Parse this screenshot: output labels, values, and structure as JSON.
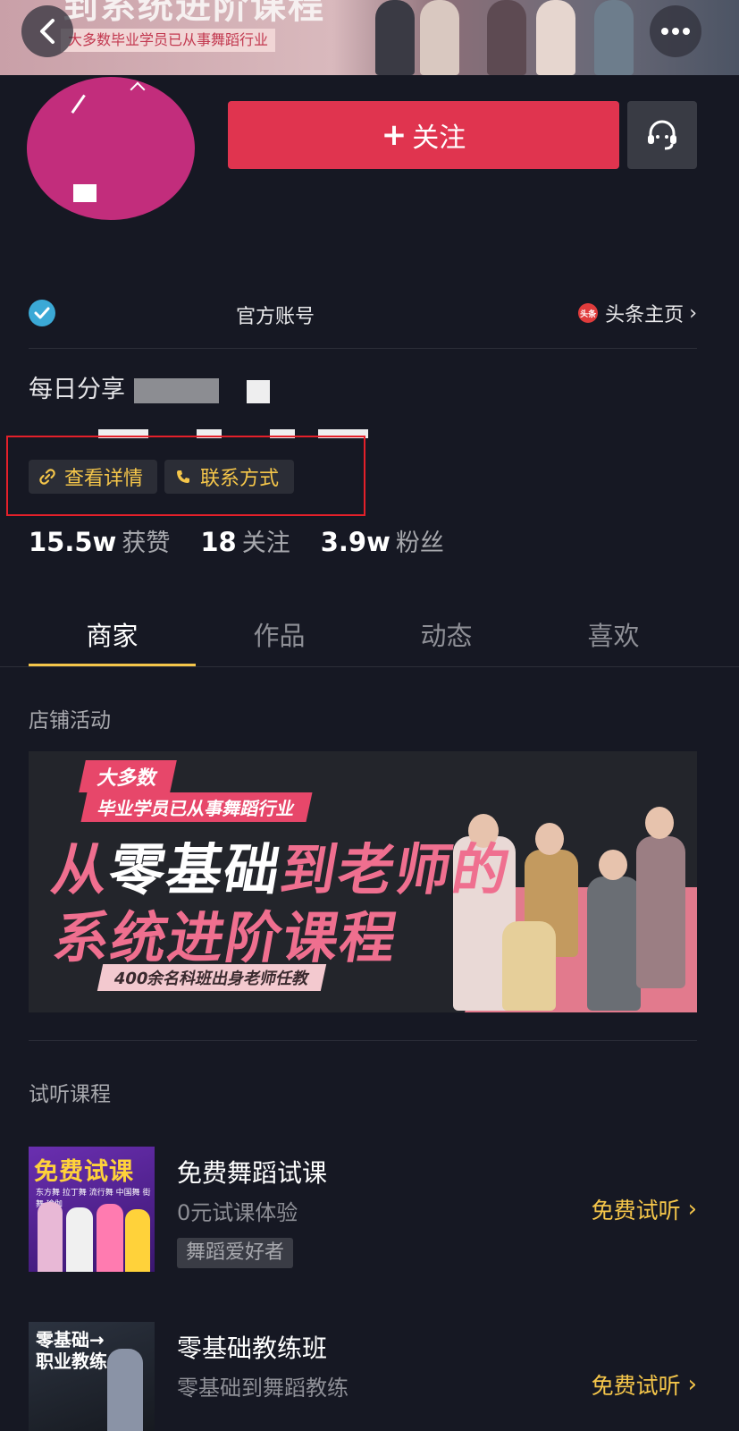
{
  "cover": {
    "title_fragment": "到系统进阶课程",
    "subtitle": "大多数毕业学员已从事舞蹈行业"
  },
  "header": {
    "follow_label": "关注"
  },
  "profile": {
    "verified_text": "官方账号",
    "toutiao_link": "头条主页",
    "toutiao_badge": "头条",
    "bio": "每日分享"
  },
  "links": {
    "details_label": "查看详情",
    "contact_label": "联系方式"
  },
  "stats": [
    {
      "value": "15.5w",
      "label": "获赞"
    },
    {
      "value": "18",
      "label": "关注"
    },
    {
      "value": "3.9w",
      "label": "粉丝"
    }
  ],
  "tabs": [
    {
      "label": "商家",
      "active": true
    },
    {
      "label": "作品",
      "active": false
    },
    {
      "label": "动态",
      "active": false
    },
    {
      "label": "喜欢",
      "active": false
    }
  ],
  "store_section": {
    "title": "店铺活动",
    "banner": {
      "tag1": "大多数",
      "tag2": "毕业学员已从事舞蹈行业",
      "line1_pink_a": "从",
      "line1_white": "零基础",
      "line1_pink_b": "到老师的",
      "line2": "系统进阶课程",
      "footer": "400余名科班出身老师任教"
    }
  },
  "trial_section": {
    "title": "试听课程",
    "courses": [
      {
        "thumb_title": "免费试课",
        "thumb_sub": "东方舞 拉丁舞 流行舞 中国舞 街舞 瑜伽",
        "title": "免费舞蹈试课",
        "subtitle": "0元试课体验",
        "tag": "舞蹈爱好者",
        "action": "免费试听"
      },
      {
        "thumb_title_a": "零基础→",
        "thumb_title_b": "职业教练",
        "title": "零基础教练班",
        "subtitle": "零基础到舞蹈教练",
        "action": "免费试听"
      }
    ]
  },
  "colors": {
    "background": "#161823",
    "accent_red": "#e0344f",
    "accent_yellow": "#f5c64a",
    "highlight_box": "#e4202a"
  }
}
